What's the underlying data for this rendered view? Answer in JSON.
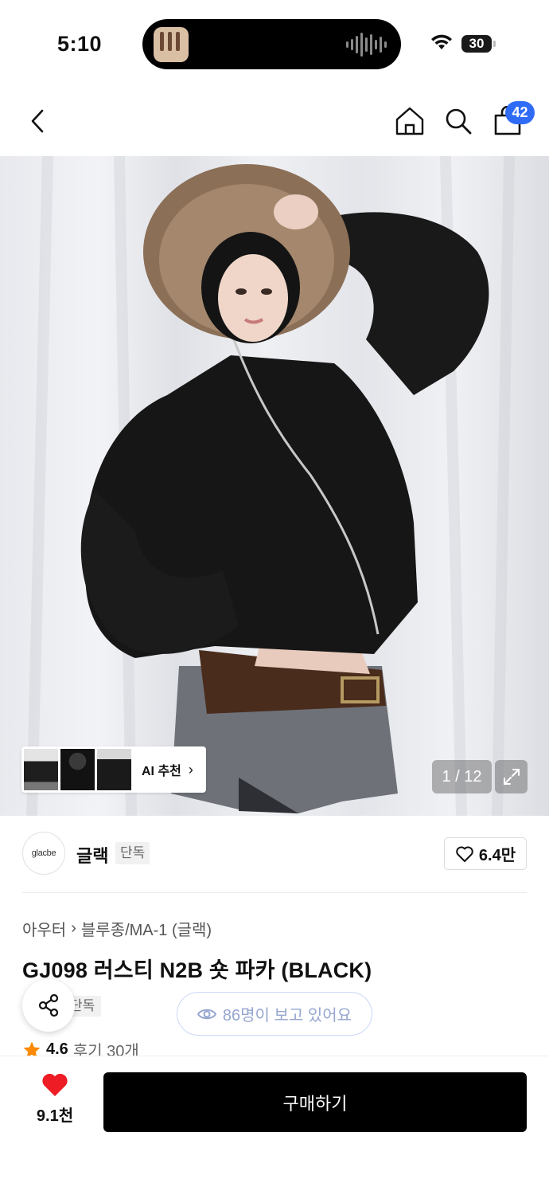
{
  "status_bar": {
    "time": "5:10",
    "battery": "30"
  },
  "header": {
    "back_icon": "chevron-left-icon",
    "home_icon": "home-icon",
    "search_icon": "search-icon",
    "cart_icon": "shopping-bag-icon",
    "cart_count": "42"
  },
  "gallery": {
    "ai_recommend_label": "AI 추천",
    "counter": "1 / 12",
    "current_index": 1,
    "total_images": 12
  },
  "brand": {
    "logo_text": "glacbe",
    "name": "글랙",
    "exclusive_label": "단독",
    "likes": "6.4만"
  },
  "product": {
    "breadcrumb": [
      "아우터",
      "블루종/MA-1 (글랙)"
    ],
    "title": "GJ098 러스티 N2B 숏 파카 (BLACK)",
    "exclusive_tag": "단독",
    "viewers": "86명이 보고 있어요",
    "rating": "4.6",
    "reviews": "후기 30개"
  },
  "bottom_bar": {
    "wish_count": "9.1천",
    "buy_label": "구매하기"
  },
  "colors": {
    "accent_blue": "#2f6bf5",
    "heart_red": "#ee1c25",
    "star_orange": "#ff8a00",
    "buy_button": "#000000"
  }
}
